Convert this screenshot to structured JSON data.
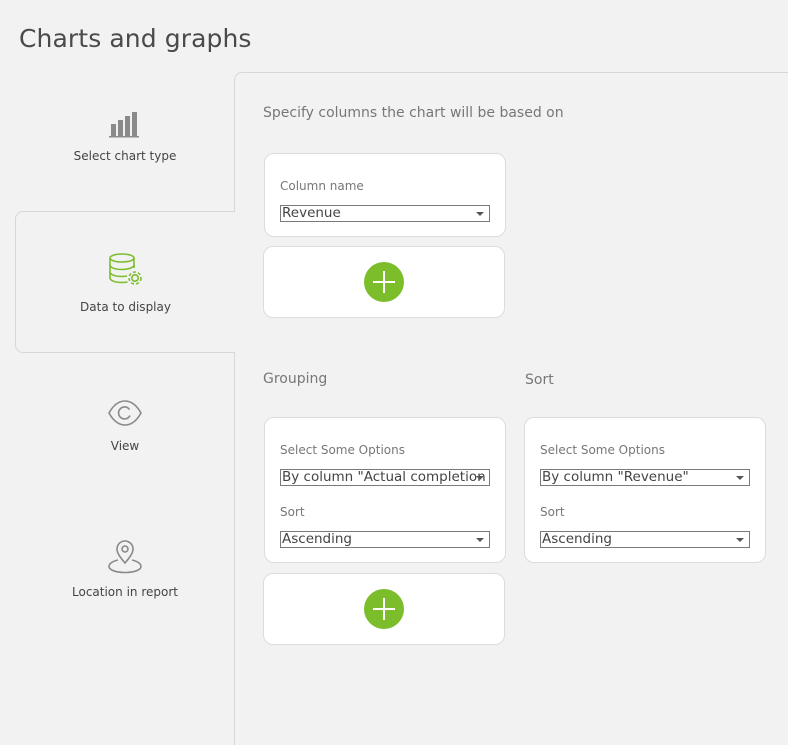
{
  "title": "Charts and graphs",
  "nav": [
    {
      "label": "Select chart type",
      "icon": "bar-chart-icon",
      "active": false
    },
    {
      "label": "Data to display",
      "icon": "database-settings-icon",
      "active": true
    },
    {
      "label": "View",
      "icon": "eye-icon",
      "active": false
    },
    {
      "label": "Location in report",
      "icon": "location-pin-icon",
      "active": false
    }
  ],
  "main": {
    "subtitle": "Specify columns the chart will be based on",
    "column_card": {
      "label": "Column name",
      "value": "Revenue"
    },
    "grouping": {
      "heading": "Grouping",
      "options_label": "Select Some Options",
      "options_value": "By column \"Actual completion da",
      "sort_label": "Sort",
      "sort_value": "Ascending"
    },
    "sort": {
      "heading": "Sort",
      "options_label": "Select Some Options",
      "options_value": "By column \"Revenue\"",
      "sort_label": "Sort",
      "sort_value": "Ascending"
    }
  },
  "colors": {
    "accent_green": "#7cbd2b",
    "background": "#f2f2f2",
    "card": "#ffffff"
  }
}
